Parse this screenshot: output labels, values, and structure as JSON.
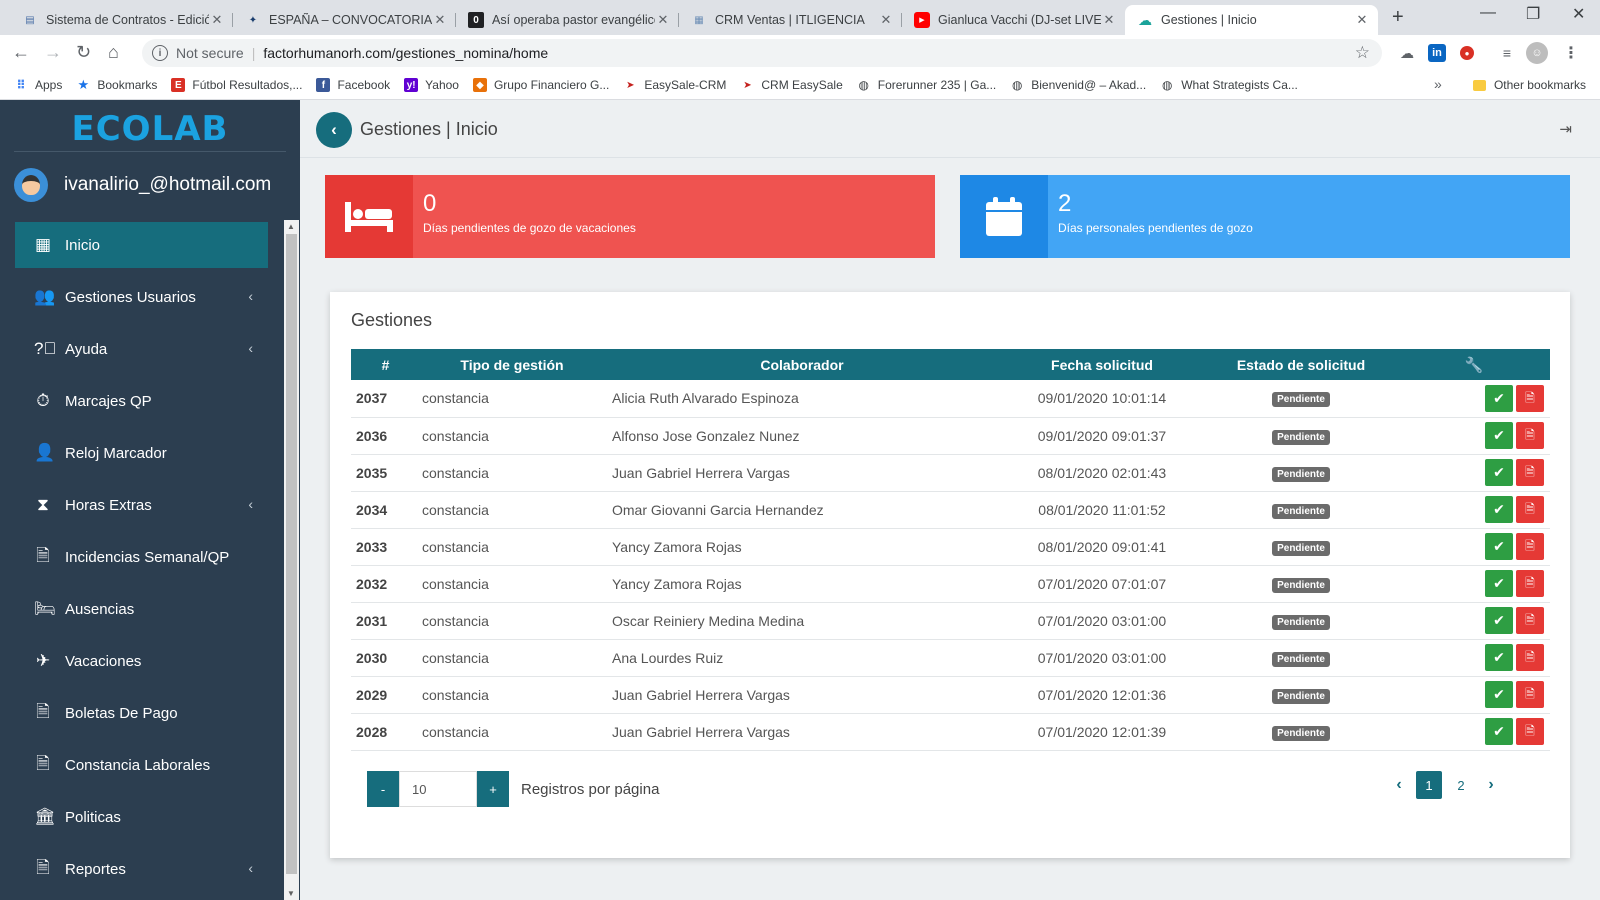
{
  "browser": {
    "tabs": [
      {
        "title": "Sistema de Contratos - Edición",
        "icon": "doc-icon",
        "active": false
      },
      {
        "title": "ESPAÑA – CONVOCATORIA DE",
        "icon": "star-logo-icon",
        "active": false
      },
      {
        "title": "Así operaba pastor evangélico",
        "icon": "news-icon",
        "active": false
      },
      {
        "title": "CRM Ventas | ITLIGENCIA",
        "icon": "crm-icon",
        "active": false
      },
      {
        "title": "Gianluca Vacchi (DJ-set LIVE @",
        "icon": "youtube-icon",
        "active": false
      },
      {
        "title": "Gestiones | Inicio",
        "icon": "cloud-icon",
        "active": true
      }
    ],
    "security": "Not secure",
    "url": "factorhumanorh.com/gestiones_nomina/home",
    "bookmarks": [
      {
        "label": "Apps",
        "color": "#4285f4"
      },
      {
        "label": "Bookmarks",
        "color": "#1a73e8"
      },
      {
        "label": "Fútbol Resultados,...",
        "color": "#d93025"
      },
      {
        "label": "Facebook",
        "color": "#3b5998"
      },
      {
        "label": "Yahoo",
        "color": "#6001d2"
      },
      {
        "label": "Grupo Financiero G...",
        "color": "#e8710a"
      },
      {
        "label": "EasySale-CRM",
        "color": "#c5221f"
      },
      {
        "label": "CRM EasySale",
        "color": "#c5221f"
      },
      {
        "label": "Forerunner 235 | Ga...",
        "color": "#3c4043"
      },
      {
        "label": "Bienvenid@ – Akad...",
        "color": "#3c4043"
      },
      {
        "label": "What Strategists Ca...",
        "color": "#3c4043"
      }
    ],
    "other_bookmarks": "Other bookmarks"
  },
  "sidebar": {
    "logo": "ECOLAB",
    "user_email": "ivanalirio_@hotmail.com",
    "items": [
      {
        "label": "Inicio",
        "icon": "dashboard-icon",
        "active": true,
        "submenu": false
      },
      {
        "label": "Gestiones Usuarios",
        "icon": "users-icon",
        "active": false,
        "submenu": true
      },
      {
        "label": "Ayuda",
        "icon": "help-icon",
        "active": false,
        "submenu": true
      },
      {
        "label": "Marcajes QP",
        "icon": "stopwatch-icon",
        "active": false,
        "submenu": false
      },
      {
        "label": "Reloj Marcador",
        "icon": "user-clock-icon",
        "active": false,
        "submenu": false
      },
      {
        "label": "Horas Extras",
        "icon": "hourglass-icon",
        "active": false,
        "submenu": true
      },
      {
        "label": "Incidencias Semanal/QP",
        "icon": "file-icon",
        "active": false,
        "submenu": false
      },
      {
        "label": "Ausencias",
        "icon": "bed-icon",
        "active": false,
        "submenu": false
      },
      {
        "label": "Vacaciones",
        "icon": "plane-icon",
        "active": false,
        "submenu": false
      },
      {
        "label": "Boletas De Pago",
        "icon": "file-pdf-icon",
        "active": false,
        "submenu": false
      },
      {
        "label": "Constancia Laborales",
        "icon": "file-text-icon",
        "active": false,
        "submenu": false
      },
      {
        "label": "Politicas",
        "icon": "institution-icon",
        "active": false,
        "submenu": false
      },
      {
        "label": "Reportes",
        "icon": "file-pdf-icon",
        "active": false,
        "submenu": true
      }
    ]
  },
  "header": {
    "title": "Gestiones | Inicio"
  },
  "stats": {
    "vacaciones": {
      "value": "0",
      "label": "Días pendientes de gozo de vacaciones",
      "color": "#ef5350"
    },
    "personales": {
      "value": "2",
      "label": "Días personales pendientes de gozo",
      "color": "#42a5f5"
    }
  },
  "gestiones": {
    "title": "Gestiones",
    "columns": [
      "#",
      "Tipo de gestión",
      "Colaborador",
      "Fecha solicitud",
      "Estado de solicitud"
    ],
    "actions_icon": "wrench-icon",
    "rows": [
      {
        "id": "2037",
        "tipo": "constancia",
        "colaborador": "Alicia Ruth Alvarado Espinoza",
        "fecha": "09/01/2020 10:01:14",
        "estado": "Pendiente"
      },
      {
        "id": "2036",
        "tipo": "constancia",
        "colaborador": "Alfonso Jose Gonzalez Nunez",
        "fecha": "09/01/2020 09:01:37",
        "estado": "Pendiente"
      },
      {
        "id": "2035",
        "tipo": "constancia",
        "colaborador": "Juan Gabriel Herrera Vargas",
        "fecha": "08/01/2020 02:01:43",
        "estado": "Pendiente"
      },
      {
        "id": "2034",
        "tipo": "constancia",
        "colaborador": "Omar Giovanni Garcia Hernandez",
        "fecha": "08/01/2020 11:01:52",
        "estado": "Pendiente"
      },
      {
        "id": "2033",
        "tipo": "constancia",
        "colaborador": "Yancy Zamora Rojas",
        "fecha": "08/01/2020 09:01:41",
        "estado": "Pendiente"
      },
      {
        "id": "2032",
        "tipo": "constancia",
        "colaborador": "Yancy Zamora Rojas",
        "fecha": "07/01/2020 07:01:07",
        "estado": "Pendiente"
      },
      {
        "id": "2031",
        "tipo": "constancia",
        "colaborador": "Oscar Reiniery Medina Medina",
        "fecha": "07/01/2020 03:01:00",
        "estado": "Pendiente"
      },
      {
        "id": "2030",
        "tipo": "constancia",
        "colaborador": "Ana Lourdes Ruiz",
        "fecha": "07/01/2020 03:01:00",
        "estado": "Pendiente"
      },
      {
        "id": "2029",
        "tipo": "constancia",
        "colaborador": "Juan Gabriel Herrera Vargas",
        "fecha": "07/01/2020 12:01:36",
        "estado": "Pendiente"
      },
      {
        "id": "2028",
        "tipo": "constancia",
        "colaborador": "Juan Gabriel Herrera Vargas",
        "fecha": "07/01/2020 12:01:39",
        "estado": "Pendiente"
      }
    ]
  },
  "pager": {
    "minus": "-",
    "plus": "+",
    "per_page": "10",
    "per_page_label": "Registros por página",
    "pages": [
      "1",
      "2"
    ],
    "current": "1"
  },
  "colors": {
    "primary": "#166d7d",
    "sidebar": "#2c3e50",
    "success": "#2e9e43",
    "danger": "#e53935"
  }
}
